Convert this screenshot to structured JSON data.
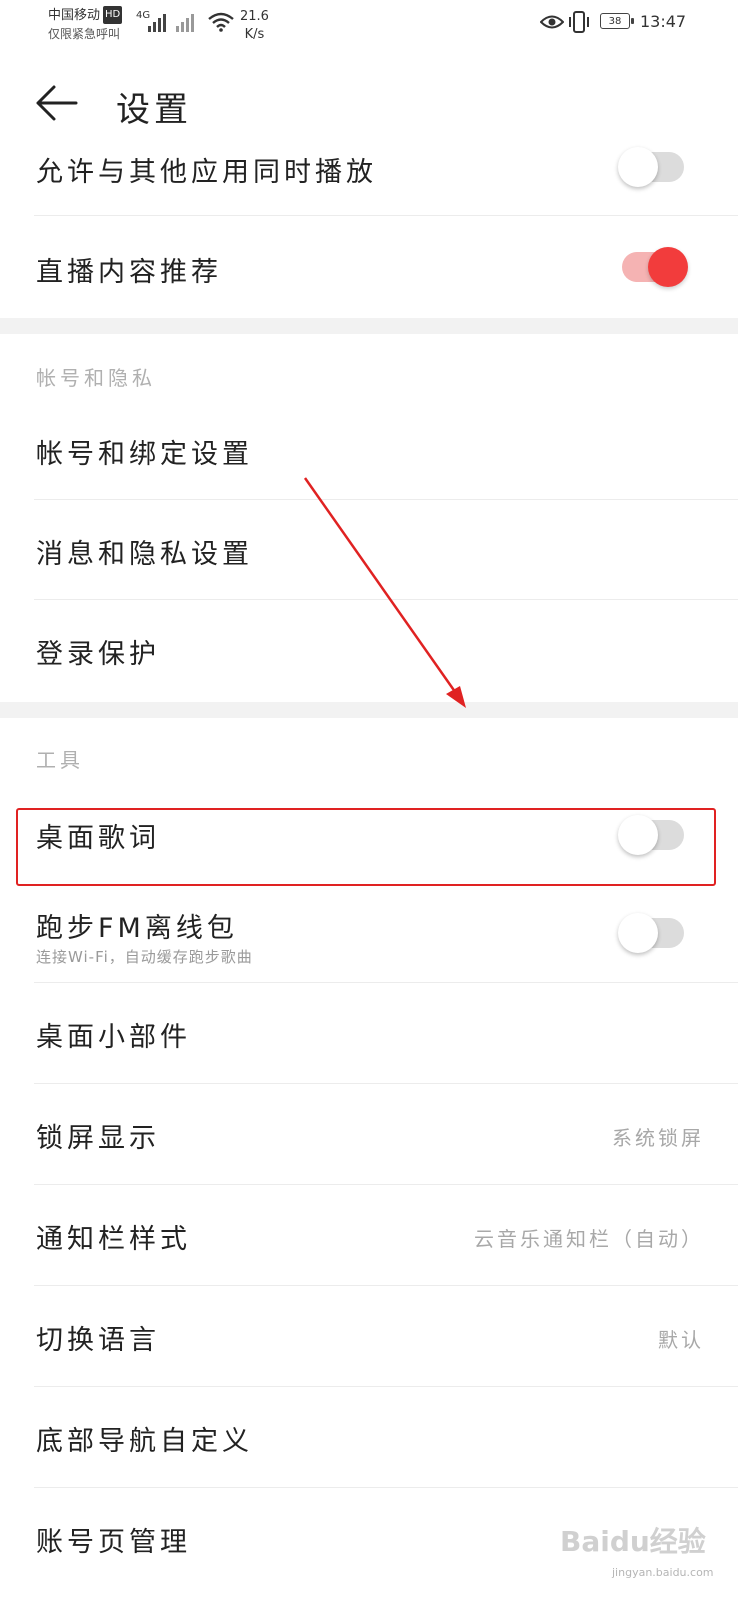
{
  "status_bar": {
    "carrier_line1": "中国移动",
    "hd": "HD",
    "carrier_line2": "仅限紧急呼叫",
    "network": "4G",
    "speed_value": "21.6",
    "speed_unit": "K/s",
    "battery": "38",
    "time": "13:47"
  },
  "header": {
    "title": "设置"
  },
  "rows": {
    "allow_playback": {
      "label": "允许与其他应用同时播放",
      "toggle": "off"
    },
    "live_recommend": {
      "label": "直播内容推荐",
      "toggle": "on"
    }
  },
  "section_account": {
    "title": "帐号和隐私",
    "items": [
      "帐号和绑定设置",
      "消息和隐私设置",
      "登录保护"
    ]
  },
  "section_tools": {
    "title": "工具",
    "desktop_lyrics": {
      "label": "桌面歌词",
      "toggle": "off"
    },
    "running_fm": {
      "label": "跑步FM离线包",
      "sub": "连接Wi-Fi，自动缓存跑步歌曲",
      "toggle": "off"
    },
    "desktop_widget": {
      "label": "桌面小部件"
    },
    "lock_screen": {
      "label": "锁屏显示",
      "value": "系统锁屏"
    },
    "notification_style": {
      "label": "通知栏样式",
      "value": "云音乐通知栏（自动）"
    },
    "language": {
      "label": "切换语言",
      "value": "默认"
    },
    "bottom_nav": {
      "label": "底部导航自定义"
    },
    "account_page": {
      "label": "账号页管理"
    }
  },
  "watermark": {
    "text": "Baidu经验",
    "sub": "jingyan.baidu.com"
  },
  "colors": {
    "accent": "#f23c3c",
    "annotation": "#e02222",
    "background": "#ffffff",
    "section_gap": "#f2f2f2"
  }
}
